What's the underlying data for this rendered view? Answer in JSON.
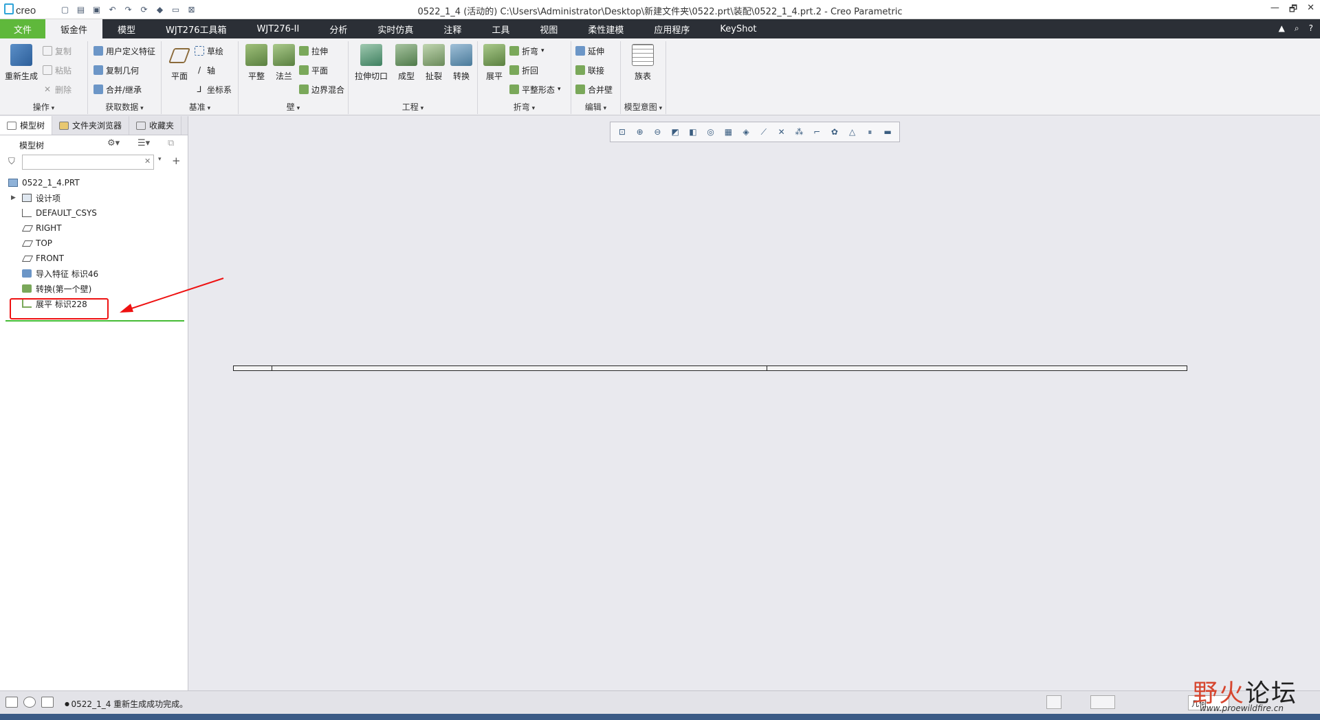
{
  "app": {
    "logo": "creo",
    "window_title": "0522_1_4 (活动的) C:\\Users\\Administrator\\Desktop\\新建文件夹\\0522.prt\\装配\\0522_1_4.prt.2 - Creo Parametric"
  },
  "quick_access": [
    "new-icon",
    "open-icon",
    "save-icon",
    "undo-icon",
    "redo-icon",
    "regenerate-icon",
    "stp-icon",
    "window-icon",
    "close-window-icon"
  ],
  "window_controls": [
    "—",
    "🗗",
    "✕"
  ],
  "tabs": [
    {
      "label": "文件"
    },
    {
      "label": "钣金件"
    },
    {
      "label": "模型"
    },
    {
      "label": "WJT276工具箱"
    },
    {
      "label": "WJT276-II"
    },
    {
      "label": "分析"
    },
    {
      "label": "实时仿真"
    },
    {
      "label": "注释"
    },
    {
      "label": "工具"
    },
    {
      "label": "视图"
    },
    {
      "label": "柔性建模"
    },
    {
      "label": "应用程序"
    },
    {
      "label": "KeyShot"
    }
  ],
  "ribbon": {
    "operations": {
      "label": "操作",
      "regenerate": "重新生成",
      "copy": "复制",
      "paste": "粘贴",
      "delete": "删除"
    },
    "get_data": {
      "label": "获取数据",
      "udf": "用户定义特征",
      "copy_geom": "复制几何",
      "merge": "合并/继承"
    },
    "datum": {
      "label": "基准",
      "plane": "平面",
      "sketch": "草绘",
      "axis": "轴",
      "csys": "坐标系"
    },
    "wall": {
      "label": "壁",
      "flat": "平整",
      "flange": "法兰",
      "extrude": "拉伸",
      "planar": "平面",
      "boundary": "边界混合"
    },
    "engineering": {
      "label": "工程",
      "extrude_cut": "拉伸切口",
      "form": "成型",
      "rip": "扯裂",
      "convert": "转换"
    },
    "bend": {
      "label": "折弯",
      "unbend": "展平",
      "bend": "折弯",
      "bend_back": "折回",
      "flat_state": "平整形态"
    },
    "edit": {
      "label": "编辑",
      "extend": "延伸",
      "join": "联接",
      "merge_wall": "合并壁"
    },
    "model_intent": {
      "label": "模型意图",
      "family_table": "族表"
    }
  },
  "panel": {
    "tabs": [
      "模型树",
      "文件夹浏览器",
      "收藏夹"
    ],
    "title": "模型树",
    "search_value": ""
  },
  "tree": [
    {
      "label": "0522_1_4.PRT",
      "icon": "part-icon"
    },
    {
      "label": "设计项",
      "icon": "design-items-icon"
    },
    {
      "label": "DEFAULT_CSYS",
      "icon": "csys-icon"
    },
    {
      "label": "RIGHT",
      "icon": "datum-plane-icon"
    },
    {
      "label": "TOP",
      "icon": "datum-plane-icon"
    },
    {
      "label": "FRONT",
      "icon": "datum-plane-icon"
    },
    {
      "label": "导入特征 标识46",
      "icon": "import-feature-icon"
    },
    {
      "label": "转换(第一个壁)",
      "icon": "convert-icon"
    },
    {
      "label": "展平 标识228",
      "icon": "unbend-icon"
    }
  ],
  "status": {
    "message": "0522_1_4 重新生成成功完成。",
    "filter": "几何"
  },
  "watermark": {
    "text_a": "野火",
    "text_b": "论坛",
    "url": "www.proewildfire.cn"
  },
  "colors": {
    "file_tab": "#5fb83b",
    "tab_bar": "#2b2f36",
    "highlight_box": "#ee1111",
    "insert_line": "#44bb33"
  }
}
